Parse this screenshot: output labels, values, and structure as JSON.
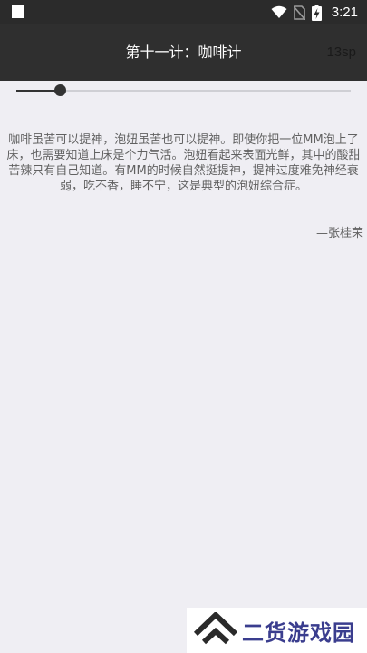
{
  "status_bar": {
    "time": "3:21",
    "icons": [
      "notification-square-icon",
      "wifi-icon",
      "no-sim-icon",
      "battery-charging-icon"
    ]
  },
  "app_bar": {
    "title": "第十一计：咖啡计",
    "font_size_label": "13sp"
  },
  "font_slider": {
    "value_fraction": 0.13
  },
  "article": {
    "body": "咖啡虽苦可以提神，泡妞虽苦也可以提神。即使你把一位MM泡上了床，也需要知道上床是个力气活。泡妞看起来表面光鲜，其中的酸甜苦辣只有自己知道。有MM的时候自然挺提神，提神过度难免神经衰弱，吃不香，睡不宁，这是典型的泡妞综合症。",
    "author": "—张桂荣"
  },
  "watermark": {
    "text": "二货游戏园"
  },
  "colors": {
    "status_bar_bg": "#2b2b2b",
    "app_bar_bg": "#2f2f2f",
    "page_bg": "#efeef3",
    "body_text": "#616161",
    "watermark_text": "#3a3d8e"
  }
}
